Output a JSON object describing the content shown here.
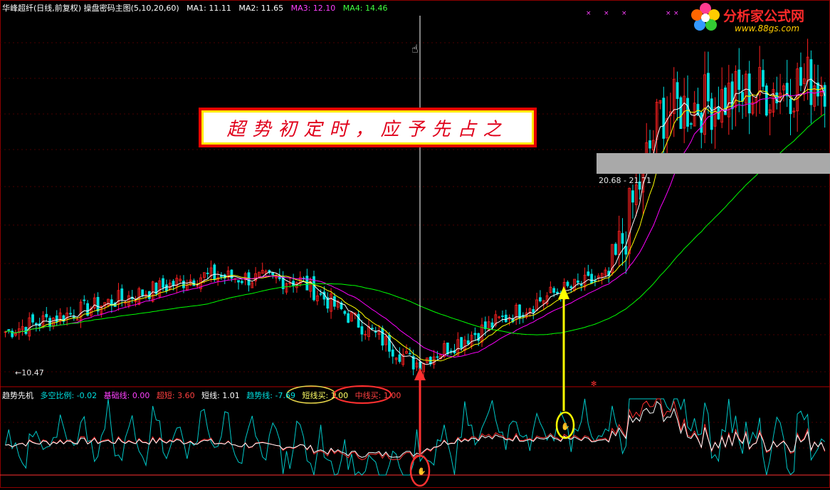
{
  "header": {
    "title": "华峰超纤(日线,前复权) 操盘密码主图(5,10,20,60)",
    "ma": [
      {
        "label": "MA1: 11.11",
        "color": "#ffffff"
      },
      {
        "label": "MA2: 11.65",
        "color": "#ffff00"
      },
      {
        "label": "MA3: 12.10",
        "color": "#ff00ff"
      },
      {
        "label": "MA4: 14.46",
        "color": "#00ff00"
      }
    ]
  },
  "banner": {
    "text": "超势初定时，应予先占之"
  },
  "logo": {
    "title": "分析家公式网",
    "url": "www.88gs.com"
  },
  "zone_label": "20.68 - 21.71",
  "low_label": "←10.47",
  "sub_header": {
    "name": "趋势先机",
    "items": [
      {
        "label": "多空比例: -0.02",
        "color": "#00e0e0"
      },
      {
        "label": "基础线: 0.00",
        "color": "#ff40ff"
      },
      {
        "label": "超短: 3.60",
        "color": "#ff4040"
      },
      {
        "label": "短线: 1.01",
        "color": "#ffffff"
      },
      {
        "label": "趋势线: -7.69",
        "color": "#00e0e0"
      },
      {
        "label": "短线买: 1.00",
        "color": "#ffff00"
      },
      {
        "label": "中线买: 1.00",
        "color": "#ff4040"
      }
    ]
  },
  "colors": {
    "up": "#ff2020",
    "down": "#00e0e0",
    "ma5": "#ffffff",
    "ma10": "#ffff00",
    "ma20": "#ff00ff",
    "ma60": "#00ff00",
    "grid": "#8b0000"
  },
  "chart_data": [
    {
      "type": "candlestick",
      "title": "华峰超纤(日线,前复权) 操盘密码主图(5,10,20,60)",
      "price_range": [
        10,
        30
      ],
      "series": [
        {
          "name": "MA1",
          "values_summary": "close ≈ 11.11 at the vertical marker"
        },
        {
          "name": "MA2"
        },
        {
          "name": "MA3"
        },
        {
          "name": "MA4"
        }
      ],
      "annotations": [
        "←10.47",
        "20.68 - 21.71"
      ],
      "key_points": {
        "x_fraction": [
          0.0,
          0.24,
          0.36,
          0.5,
          0.67,
          0.74,
          0.8,
          1.0
        ],
        "close": [
          12.5,
          15.8,
          15.5,
          10.6,
          14.8,
          15.8,
          25.5,
          27.5
        ]
      }
    },
    {
      "type": "line",
      "title": "趋势先机",
      "series": [
        {
          "name": "短线",
          "color": "#ffffff"
        },
        {
          "name": "超短",
          "color": "#ff4040"
        },
        {
          "name": "多空比例",
          "color": "#00e0e0"
        }
      ]
    }
  ]
}
